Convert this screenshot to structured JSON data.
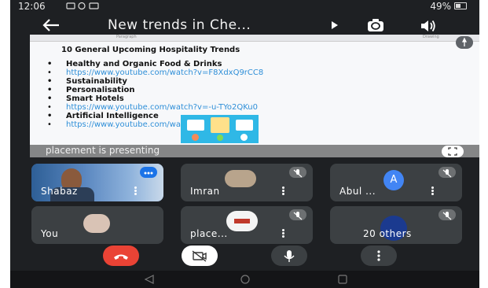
{
  "status_bar": {
    "time": "12:06",
    "battery": "49%"
  },
  "app_bar": {
    "title": "New trends in Che...",
    "icons": [
      "back-arrow-icon",
      "cast-icon",
      "switch-camera-icon",
      "speaker-icon"
    ]
  },
  "presentation": {
    "ruler_left": "Paragraph",
    "ruler_right": "Drawing",
    "heading": "10 General Upcoming Hospitality Trends",
    "items": [
      {
        "text": "Healthy and Organic Food & Drinks",
        "kind": "bold"
      },
      {
        "text": "https://www.youtube.com/watch?v=F8XdxQ9rCC8",
        "kind": "link"
      },
      {
        "text": "Sustainability",
        "kind": "bold"
      },
      {
        "text": "Personalisation",
        "kind": "bold"
      },
      {
        "text": "Smart Hotels",
        "kind": "bold"
      },
      {
        "text": "https://www.youtube.com/watch?v=-u-TYo2QKu0",
        "kind": "link"
      },
      {
        "text": "Artificial Intelligence",
        "kind": "bold"
      },
      {
        "text": "https://www.youtube.com/watch?v=Y84M_7Alito",
        "kind": "link"
      }
    ],
    "presenter_banner": "placement is presenting"
  },
  "participants": [
    {
      "name": "Shabaz",
      "type": "video",
      "speaking": true
    },
    {
      "name": "Imran",
      "type": "avatar",
      "muted": true
    },
    {
      "name": "Abul ...",
      "type": "letter",
      "letter": "A",
      "muted": true
    },
    {
      "name": "You",
      "type": "avatar"
    },
    {
      "name": "place...",
      "type": "avatar",
      "muted": true
    },
    {
      "name": "20 others",
      "type": "group",
      "muted": true
    }
  ],
  "colors": {
    "end_call": "#ea4335",
    "tile_bg": "#3c4043",
    "link": "#2f8fd8",
    "avatar_letter_bg": "#4285f4"
  }
}
